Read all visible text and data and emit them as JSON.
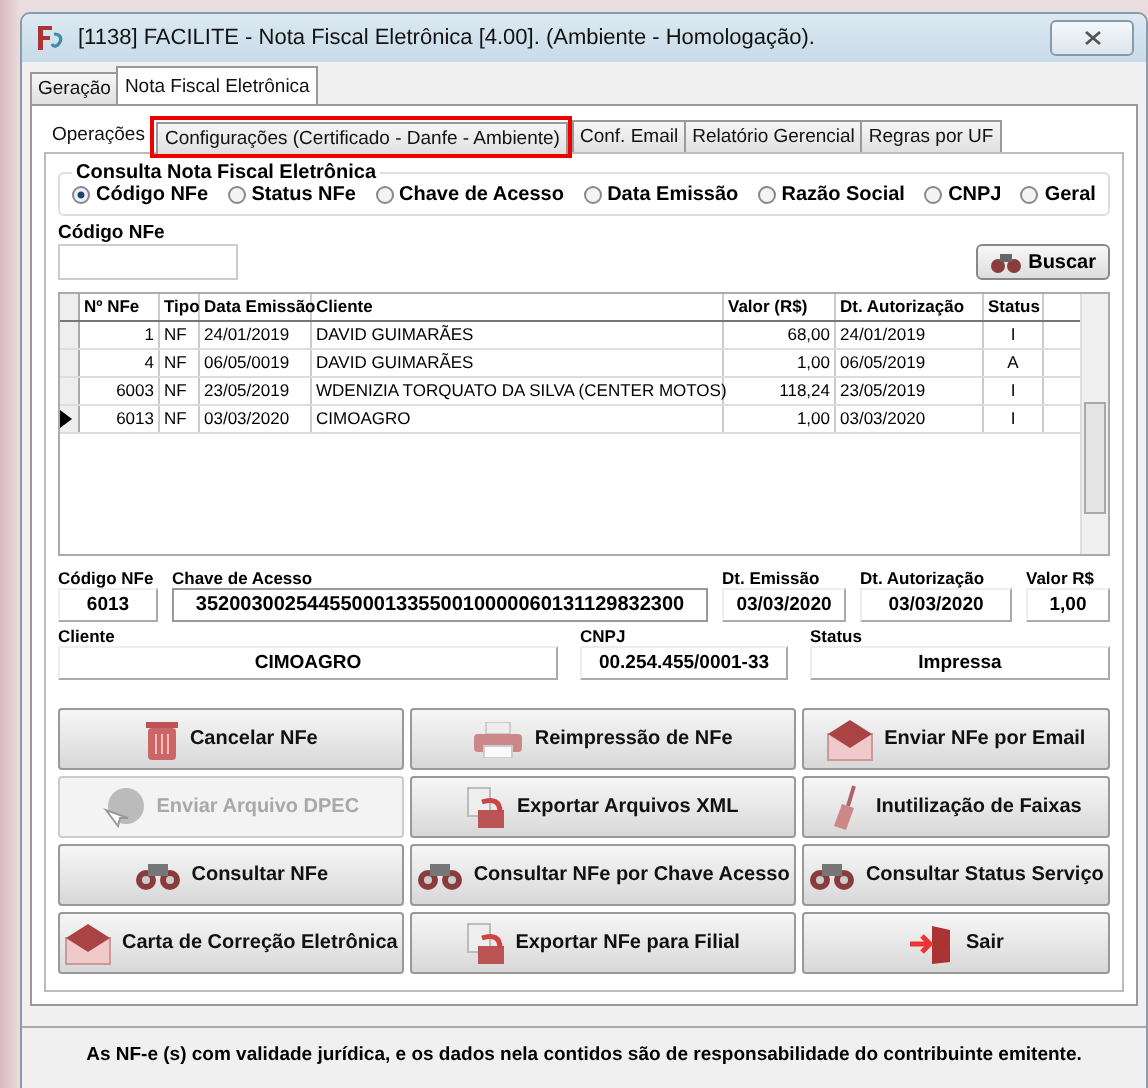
{
  "window": {
    "title": "[1138] FACILITE - Nota Fiscal Eletrônica [4.00]. (Ambiente - Homologação)."
  },
  "tabs": [
    {
      "label": "Geração",
      "selected": false
    },
    {
      "label": "Nota Fiscal Eletrônica",
      "selected": true
    }
  ],
  "subtabs": [
    {
      "label": "Operações",
      "selected": true,
      "highlighted": false
    },
    {
      "label": "Configurações (Certificado - Danfe - Ambiente)",
      "selected": false,
      "highlighted": true
    },
    {
      "label": "Conf. Email",
      "selected": false,
      "highlighted": false
    },
    {
      "label": "Relatório Gerencial",
      "selected": false,
      "highlighted": false
    },
    {
      "label": "Regras por UF",
      "selected": false,
      "highlighted": false
    }
  ],
  "query_group": {
    "title": "Consulta Nota Fiscal Eletrônica",
    "options": [
      {
        "label": "Código NFe",
        "selected": true
      },
      {
        "label": "Status NFe",
        "selected": false
      },
      {
        "label": "Chave de Acesso",
        "selected": false
      },
      {
        "label": "Data Emissão",
        "selected": false
      },
      {
        "label": "Razão Social",
        "selected": false
      },
      {
        "label": "CNPJ",
        "selected": false
      },
      {
        "label": "Geral",
        "selected": false
      }
    ]
  },
  "search": {
    "label": "Código NFe",
    "button": "Buscar"
  },
  "table": {
    "columns": [
      "Nº NFe",
      "Tipo",
      "Data Emissão",
      "Cliente",
      "Valor (R$)",
      "Dt. Autorização",
      "Status"
    ],
    "rows": [
      {
        "cells": [
          "1",
          "NF",
          "24/01/2019",
          "DAVID GUIMARÃES",
          "68,00",
          "24/01/2019",
          "I"
        ],
        "selected": false
      },
      {
        "cells": [
          "4",
          "NF",
          "06/05/0019",
          "DAVID GUIMARÃES",
          "1,00",
          "06/05/2019",
          "A"
        ],
        "selected": false
      },
      {
        "cells": [
          "6003",
          "NF",
          "23/05/2019",
          "WDENIZIA TORQUATO DA SILVA (CENTER MOTOS)",
          "118,24",
          "23/05/2019",
          "I"
        ],
        "selected": false
      },
      {
        "cells": [
          "6013",
          "NF",
          "03/03/2020",
          "CIMOAGRO",
          "1,00",
          "03/03/2020",
          "I"
        ],
        "selected": true
      }
    ]
  },
  "details": {
    "row1": [
      {
        "label": "Código NFe",
        "value": "6013"
      },
      {
        "label": "Chave de Acesso",
        "value": "35200300254455000133550010000060131129832300"
      },
      {
        "label": "Dt. Emissão",
        "value": "03/03/2020"
      },
      {
        "label": "Dt. Autorização",
        "value": "03/03/2020"
      },
      {
        "label": "Valor R$",
        "value": "1,00"
      }
    ],
    "row2": [
      {
        "label": "Cliente",
        "value": "CIMOAGRO"
      },
      {
        "label": "CNPJ",
        "value": "00.254.455/0001-33"
      },
      {
        "label": "Status",
        "value": "Impressa"
      }
    ]
  },
  "buttons": [
    {
      "label": "Cancelar NFe",
      "kind": "trash",
      "disabled": false
    },
    {
      "label": "Reimpressão de NFe",
      "kind": "printer",
      "disabled": false
    },
    {
      "label": "Enviar NFe por Email",
      "kind": "envelope",
      "disabled": false
    },
    {
      "label": "Enviar Arquivo DPEC",
      "kind": "globe",
      "disabled": true
    },
    {
      "label": "Exportar Arquivos XML",
      "kind": "export",
      "disabled": false
    },
    {
      "label": "Inutilização de Faixas",
      "kind": "broom",
      "disabled": false
    },
    {
      "label": "Consultar NFe",
      "kind": "binoculars",
      "disabled": false
    },
    {
      "label": "Consultar NFe por Chave Acesso",
      "kind": "binoculars",
      "disabled": false
    },
    {
      "label": "Consultar Status Serviço",
      "kind": "binoculars",
      "disabled": false
    },
    {
      "label": "Carta de Correção Eletrônica",
      "kind": "envelope",
      "disabled": false
    },
    {
      "label": "Exportar NFe para Filial",
      "kind": "export",
      "disabled": false
    },
    {
      "label": "Sair",
      "kind": "door",
      "disabled": false
    }
  ],
  "footer": "As NF-e (s) com validade jurídica, e os dados nela contidos são de responsabilidade do contribuinte emitente."
}
